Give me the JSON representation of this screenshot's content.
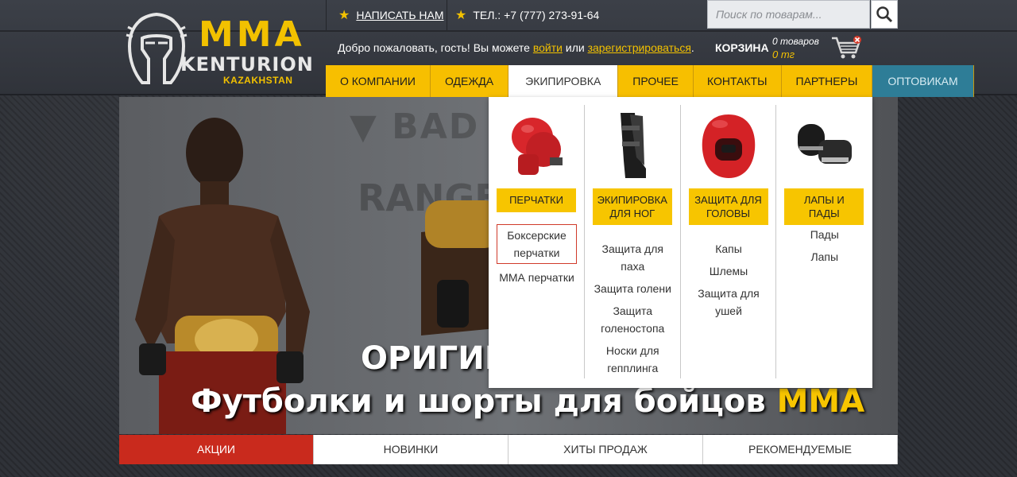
{
  "logo": {
    "top": "MMA",
    "middle": "KENTURION",
    "bottom": "KAZAKHSTAN"
  },
  "header": {
    "write_label": "НАПИСАТЬ НАМ",
    "phone_label": "ТЕЛ.: +7 (777) 273-91-64",
    "search_placeholder": "Поиск по товарам...",
    "welcome_prefix": "Добро пожаловать, гость! Вы можете ",
    "login_link": "войти",
    "welcome_mid": " или ",
    "register_link": "зарегистрироваться",
    "welcome_end": "."
  },
  "cart": {
    "label": "КОРЗИНА",
    "items": "0 товаров",
    "total": "0 тг"
  },
  "nav": {
    "items": [
      {
        "label": "О КОМПАНИИ"
      },
      {
        "label": "ОДЕЖДА"
      },
      {
        "label": "ЭКИПИРОВКА"
      },
      {
        "label": "ПРОЧЕЕ"
      },
      {
        "label": "КОНТАКТЫ"
      },
      {
        "label": "ПАРТНЕРЫ"
      },
      {
        "label": "ОПТОВИКАМ"
      }
    ]
  },
  "banner": {
    "title": "ОРИГИН",
    "subtitle_main": "Футболки и шорты для бойцов ",
    "subtitle_highlight": "MMA"
  },
  "dropdown": {
    "columns": [
      {
        "category": "ПЕРЧАТКИ",
        "links": [
          "Боксерские перчатки",
          "ММА перчатки"
        ]
      },
      {
        "category": "ЭКИПИРОВКА ДЛЯ НОГ",
        "links": [
          "Защита для паха",
          "Защита голени",
          "Защита голеностопа",
          "Носки для гепплинга"
        ]
      },
      {
        "category": "ЗАЩИТА ДЛЯ ГОЛОВЫ",
        "links": [
          "Капы",
          "Шлемы",
          "Защита для ушей"
        ]
      },
      {
        "category": "ЛАПЫ И ПАДЫ",
        "links": [
          "Пады",
          "Лапы"
        ]
      }
    ]
  },
  "tabs": [
    {
      "label": "АКЦИИ"
    },
    {
      "label": "НОВИНКИ"
    },
    {
      "label": "ХИТЫ ПРОДАЖ"
    },
    {
      "label": "РЕКОМЕНДУЕМЫЕ"
    }
  ],
  "colors": {
    "accent": "#f7c500",
    "active_tab": "#c92a1d",
    "wholesale": "#2e7d97"
  }
}
